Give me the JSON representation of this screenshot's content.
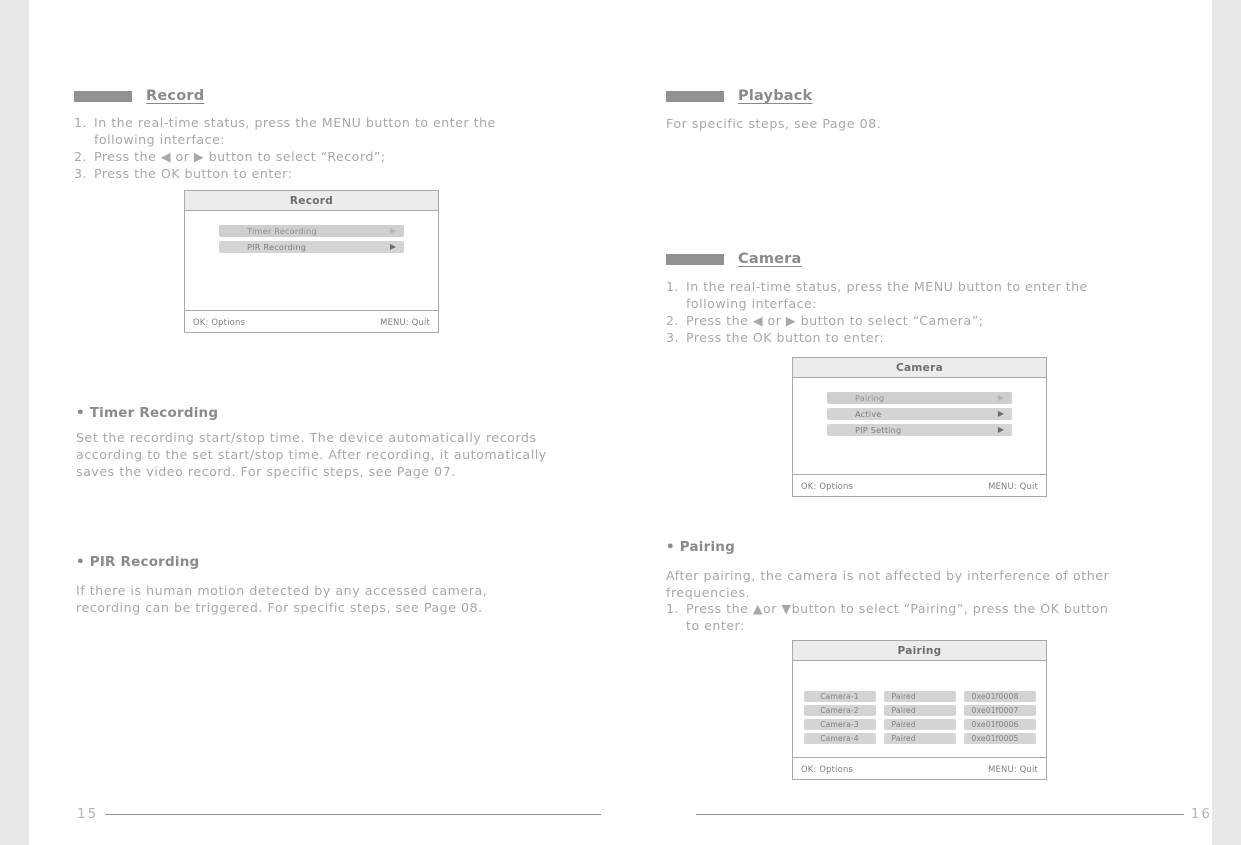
{
  "document": {
    "left_page": {
      "page_number": "15",
      "sections": [
        {
          "heading": "Record",
          "steps": [
            {
              "num": "1.",
              "text": "In the real-time status, press the MENU button to enter the\nfollowing interface:"
            },
            {
              "num": "2.",
              "text": "Press the ◀ or ▶ button to select “Record”;"
            },
            {
              "num": "3.",
              "text": "Press the OK button to enter:"
            }
          ]
        }
      ],
      "record_menu": {
        "title": "Record",
        "items": [
          {
            "label": "Timer  Recording",
            "caret": "▶",
            "selected": true
          },
          {
            "label": "PIR  Recording",
            "caret": "▶",
            "selected": false
          }
        ],
        "footer_left": "OK: Options",
        "footer_right": "MENU: Quit"
      },
      "timer_recording": {
        "heading": "• Timer Recording",
        "body": "Set the recording start/stop time. The device automatically records\naccording to the set start/stop time. After recording, it automatically\nsaves the video record. For specific steps, see Page 07."
      },
      "pir_recording": {
        "heading": "• PIR Recording",
        "body": "If there is human motion detected by any accessed camera,\nrecording can be triggered. For specific steps, see Page 08."
      }
    },
    "right_page": {
      "page_number": "16",
      "playback": {
        "heading": "Playback",
        "body": "For specific steps, see Page 08."
      },
      "camera": {
        "heading": "Camera",
        "steps": [
          {
            "num": "1.",
            "text": "In the real-time status, press the MENU button to enter the\nfollowing interface:"
          },
          {
            "num": "2.",
            "text": "Press the ◀ or ▶ button to select “Camera”;"
          },
          {
            "num": "3.",
            "text": "Press the OK button to enter:"
          }
        ]
      },
      "camera_menu": {
        "title": "Camera",
        "items": [
          {
            "label": "Pairing",
            "caret": "▶",
            "selected": true
          },
          {
            "label": "Active",
            "caret": "▶",
            "selected": false
          },
          {
            "label": "PIP  Setting",
            "caret": "▶",
            "selected": false
          }
        ],
        "footer_left": "OK: Options",
        "footer_right": "MENU: Quit"
      },
      "pairing": {
        "heading": "• Pairing",
        "body": "After pairing, the camera is not affected by interference of other\nfrequencies.",
        "steps": [
          {
            "num": "1.",
            "text": "Press the ▲or ▼button to select “Pairing”, press the OK button\nto enter:"
          }
        ]
      },
      "pairing_menu": {
        "title": "Pairing",
        "rows": [
          {
            "name": "Camera-1",
            "state": "Paired",
            "id": "0xe01f0008"
          },
          {
            "name": "Camera-2",
            "state": "Paired",
            "id": "0xe01f0007"
          },
          {
            "name": "Camera-3",
            "state": "Paired",
            "id": "0xe01f0006"
          },
          {
            "name": "Camera-4",
            "state": "Paired",
            "id": "0xe01f0005"
          }
        ],
        "footer_left": "OK: Options",
        "footer_right": "MENU: Quit"
      }
    }
  },
  "colors": {
    "page_background": "#ffffff",
    "canvas_background": "#e8e8e8",
    "heading_swatch": "#919191",
    "heading_text": "#8a8a8a",
    "body_text": "#a8a8a8",
    "menu_row": "#d4d4d4",
    "menu_border": "#a9a9a9"
  }
}
